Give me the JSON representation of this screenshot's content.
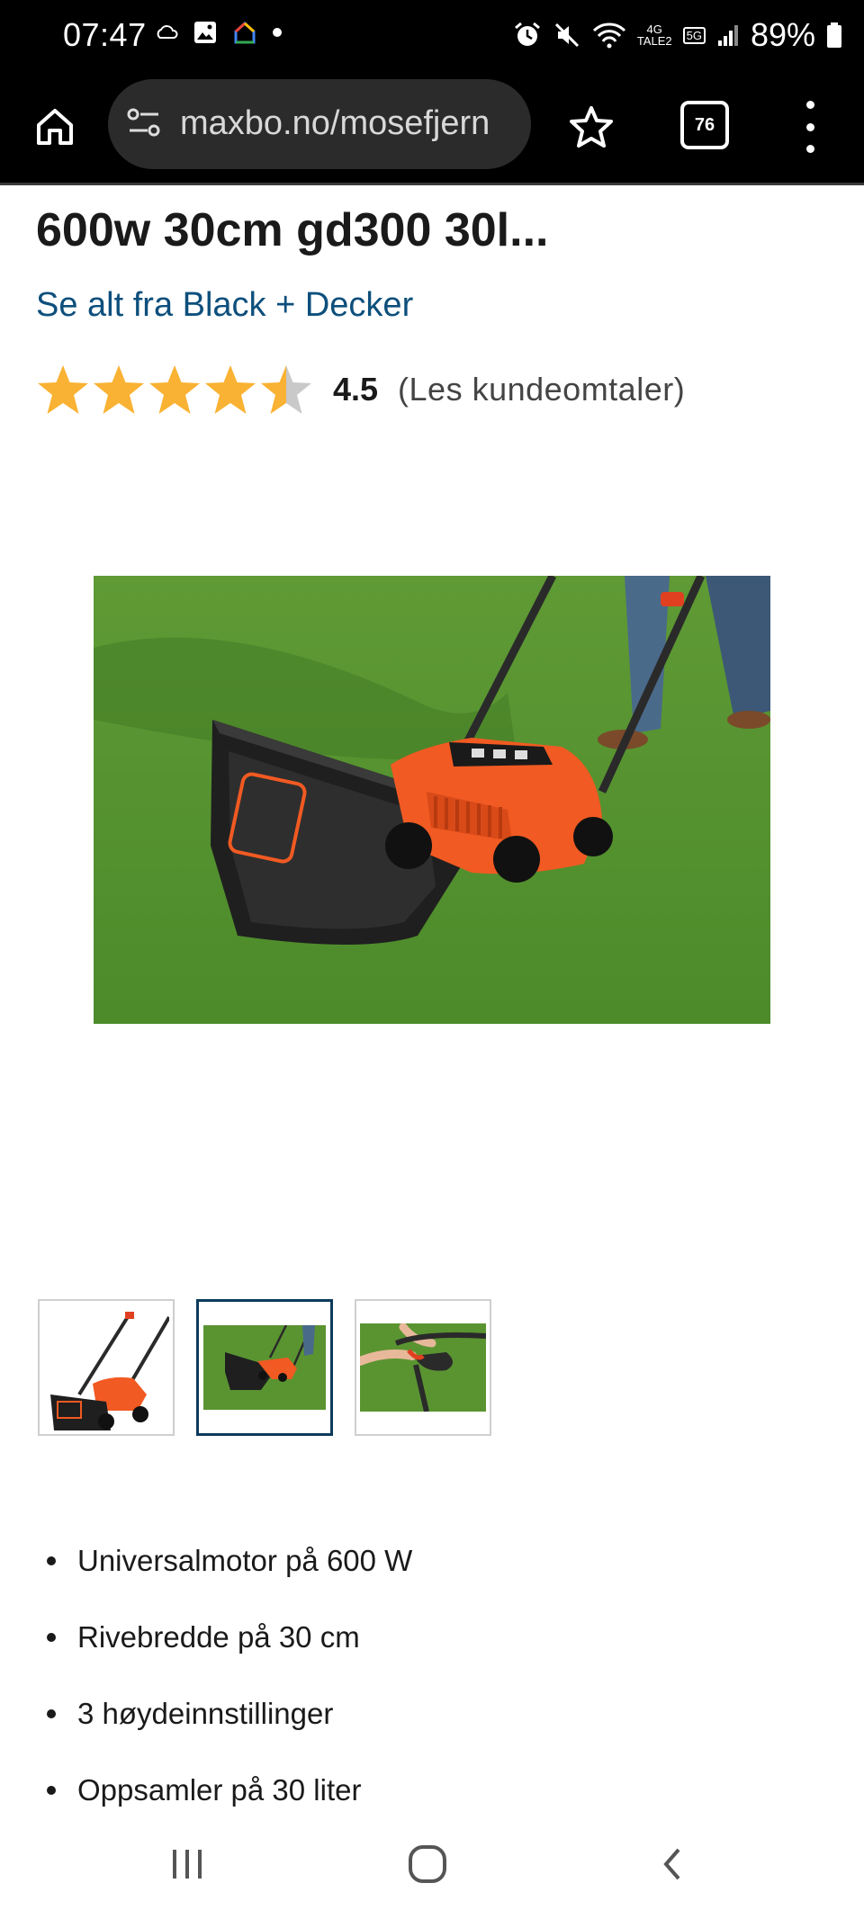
{
  "status_bar": {
    "time": "07:47",
    "network_4g": "4G",
    "network_sub": "TALE2",
    "network_5g": "5G",
    "battery_percent": "89%",
    "icons": [
      "cloud-icon",
      "gallery-icon",
      "home-app-icon",
      "dot-icon",
      "alarm-icon",
      "mute-icon",
      "wifi-icon",
      "signal-icon",
      "battery-icon"
    ]
  },
  "browser": {
    "url": "maxbo.no/mosefjern",
    "tab_count": "76",
    "icons": [
      "home-icon",
      "site-settings-icon",
      "star-icon",
      "tabs-icon",
      "more-icon"
    ]
  },
  "product": {
    "title": "600w 30cm gd300 30l...",
    "brand_link": "Se alt fra Black + Decker",
    "rating_value": "4.5",
    "rating_max": 5,
    "review_link": "(Les  kundeomtaler)",
    "main_image_alt": "Black+Decker plenlufter på gress",
    "thumbnail_count": 3,
    "selected_thumbnail": 2
  },
  "features": [
    "Universalmotor på 600 W",
    "Rivebredde på 30 cm",
    "3 høydeinnstillinger",
    "Oppsamler på 30 liter"
  ],
  "colors": {
    "brand_link": "#0d4f7c",
    "star": "#f9b233",
    "active_thumb_border": "#0d3b5c",
    "machine_orange": "#f15a22"
  }
}
